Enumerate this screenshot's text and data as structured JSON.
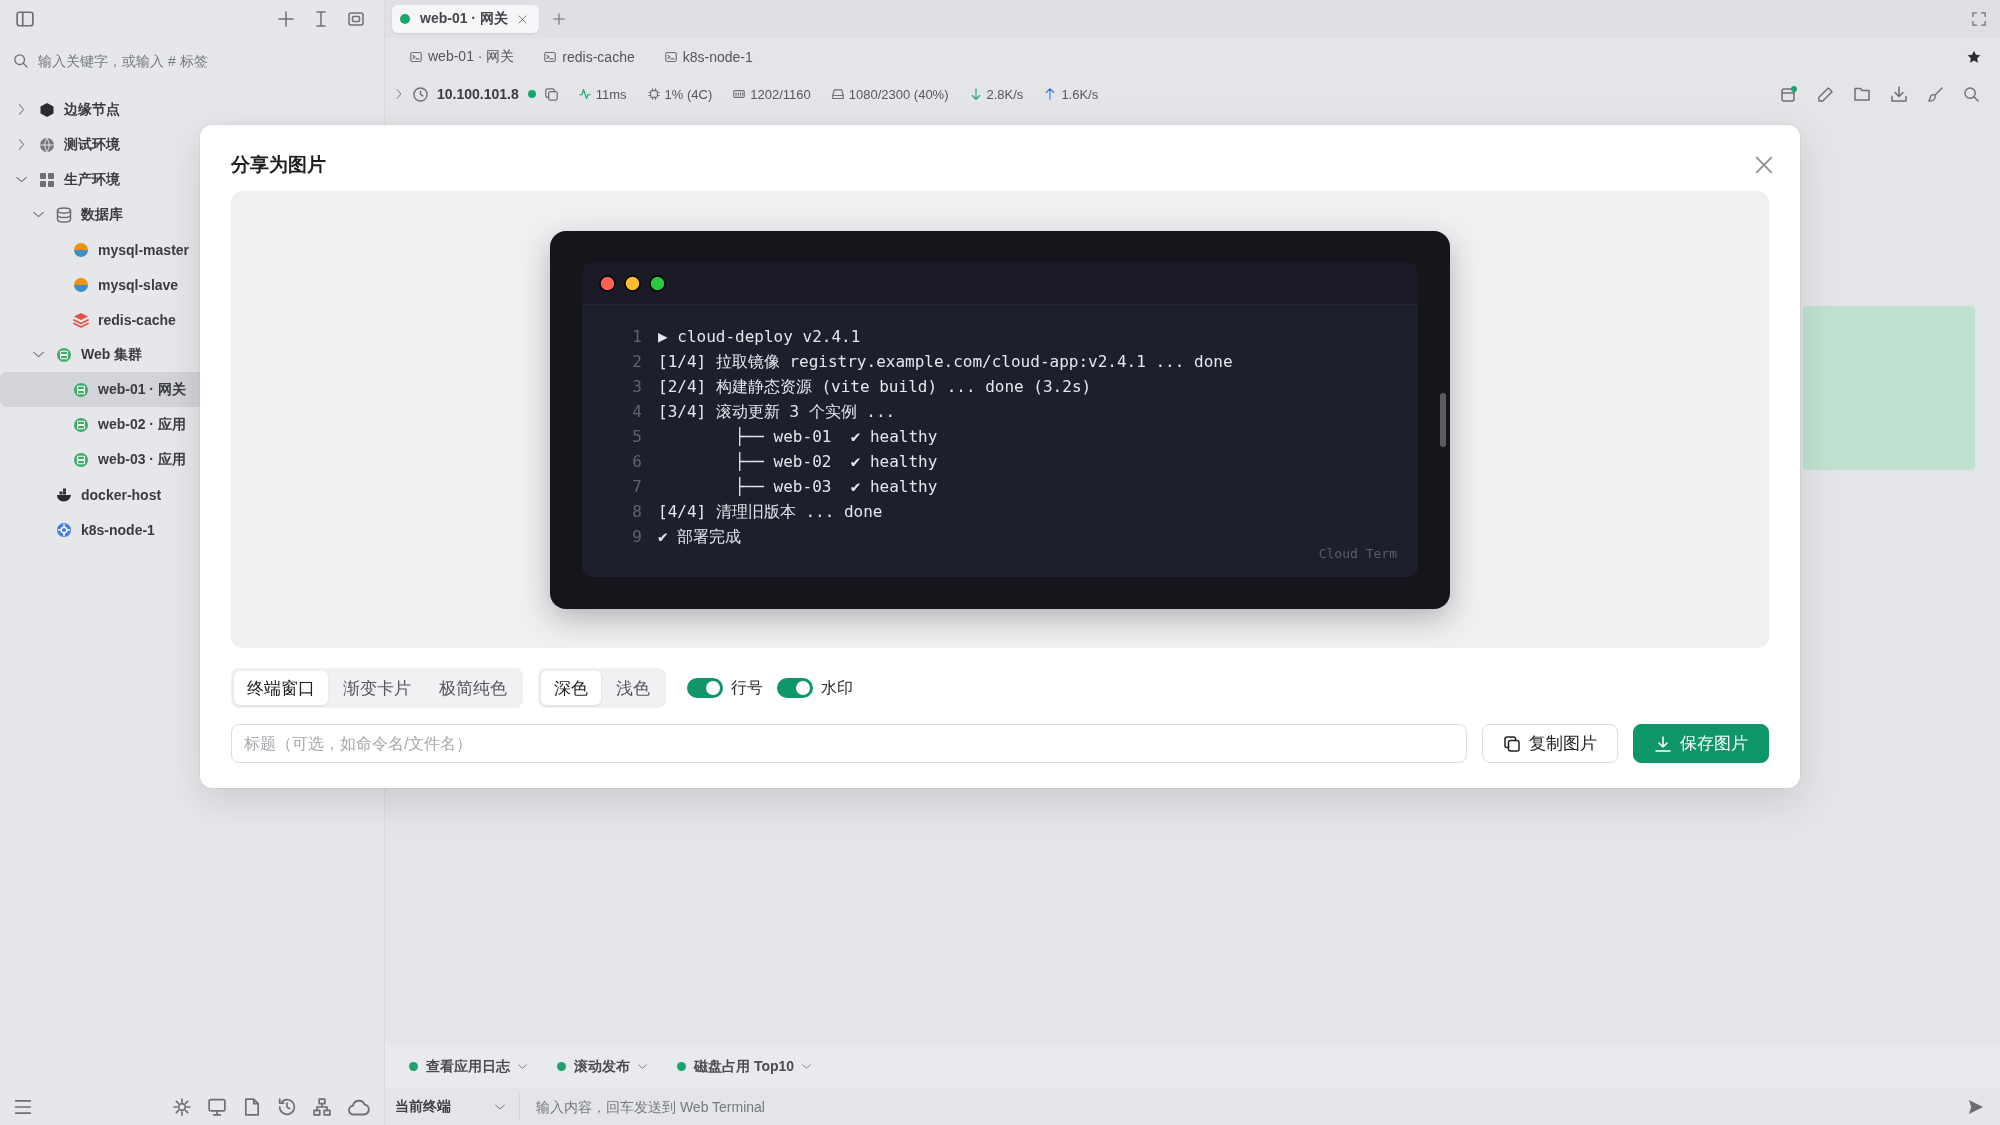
{
  "app": {
    "sidebar": {
      "search": {
        "placeholder": "输入关键字，或输入 # 标签"
      },
      "tree": [
        {
          "label": "边缘节点",
          "kind": "edge",
          "expanded": false,
          "selected": false
        },
        {
          "label": "测试环境",
          "kind": "env",
          "expanded": false,
          "selected": false
        },
        {
          "label": "生产环境",
          "kind": "grid",
          "expanded": true,
          "selected": false,
          "children": [
            {
              "label": "数据库",
              "kind": "database",
              "expanded": true,
              "selected": false,
              "children": [
                {
                  "label": "mysql-master",
                  "kind": "mysql",
                  "selected": false
                },
                {
                  "label": "mysql-slave",
                  "kind": "mysql",
                  "selected": false
                },
                {
                  "label": "redis-cache",
                  "kind": "redis",
                  "selected": false
                }
              ]
            },
            {
              "label": "Web 集群",
              "kind": "cluster",
              "expanded": true,
              "selected": false,
              "children": [
                {
                  "label": "web-01 · 网关",
                  "kind": "server",
                  "selected": true
                },
                {
                  "label": "web-02 · 应用",
                  "kind": "server",
                  "selected": false
                },
                {
                  "label": "web-03 · 应用",
                  "kind": "server",
                  "selected": false
                }
              ]
            },
            {
              "label": "docker-host",
              "kind": "docker",
              "selected": false
            },
            {
              "label": "k8s-node-1",
              "kind": "k8s",
              "selected": false
            }
          ]
        }
      ]
    },
    "tabs": [
      {
        "label": "web-01 · 网关",
        "selected": true
      }
    ],
    "session_tabs": [
      {
        "label": "web-01 · 网关"
      },
      {
        "label": "redis-cache"
      },
      {
        "label": "k8s-node-1"
      }
    ],
    "status": {
      "host": "10.100.101.8",
      "online": true,
      "metrics": [
        {
          "kind": "latency",
          "text": "11ms"
        },
        {
          "kind": "cpu",
          "text": "1% (4C)"
        },
        {
          "kind": "memory",
          "text": "1202/1160"
        },
        {
          "kind": "disk",
          "text": "1080/2300 (40%)"
        },
        {
          "kind": "download",
          "text": "2.8K/s"
        },
        {
          "kind": "upload",
          "text": "1.6K/s"
        }
      ]
    },
    "quick_commands": [
      {
        "label": "查看应用日志"
      },
      {
        "label": "滚动发布"
      },
      {
        "label": "磁盘占用 Top10"
      }
    ],
    "command_bar": {
      "target": "当前终端",
      "placeholder": "输入内容，回车发送到 Web Terminal"
    }
  },
  "dialog": {
    "title": "分享为图片",
    "preview": {
      "lines": [
        {
          "number": "1",
          "text": "▶ cloud-deploy v2.4.1"
        },
        {
          "number": "2",
          "text": "[1/4] 拉取镜像 registry.example.com/cloud-app:v2.4.1 ... done"
        },
        {
          "number": "3",
          "text": "[2/4] 构建静态资源 (vite build) ... done (3.2s)"
        },
        {
          "number": "4",
          "text": "[3/4] 滚动更新 3 个实例 ..."
        },
        {
          "number": "5",
          "text": "        ├── web-01  ✔ healthy"
        },
        {
          "number": "6",
          "text": "        ├── web-02  ✔ healthy"
        },
        {
          "number": "7",
          "text": "        ├── web-03  ✔ healthy"
        },
        {
          "number": "8",
          "text": "[4/4] 清理旧版本 ... done"
        },
        {
          "number": "9",
          "text": "✔ 部署完成"
        }
      ],
      "watermark": "Cloud Term"
    },
    "styles": [
      {
        "label": "终端窗口",
        "selected": true
      },
      {
        "label": "渐变卡片",
        "selected": false
      },
      {
        "label": "极简纯色",
        "selected": false
      }
    ],
    "themes": [
      {
        "label": "深色",
        "selected": true
      },
      {
        "label": "浅色",
        "selected": false
      }
    ],
    "toggles": [
      {
        "label": "行号",
        "on": true
      },
      {
        "label": "水印",
        "on": true
      }
    ],
    "title_field": {
      "placeholder": "标题（可选，如命令名/文件名）"
    },
    "buttons": [
      {
        "label": "复制图片",
        "kind": "secondary"
      },
      {
        "label": "保存图片",
        "kind": "primary"
      }
    ]
  }
}
